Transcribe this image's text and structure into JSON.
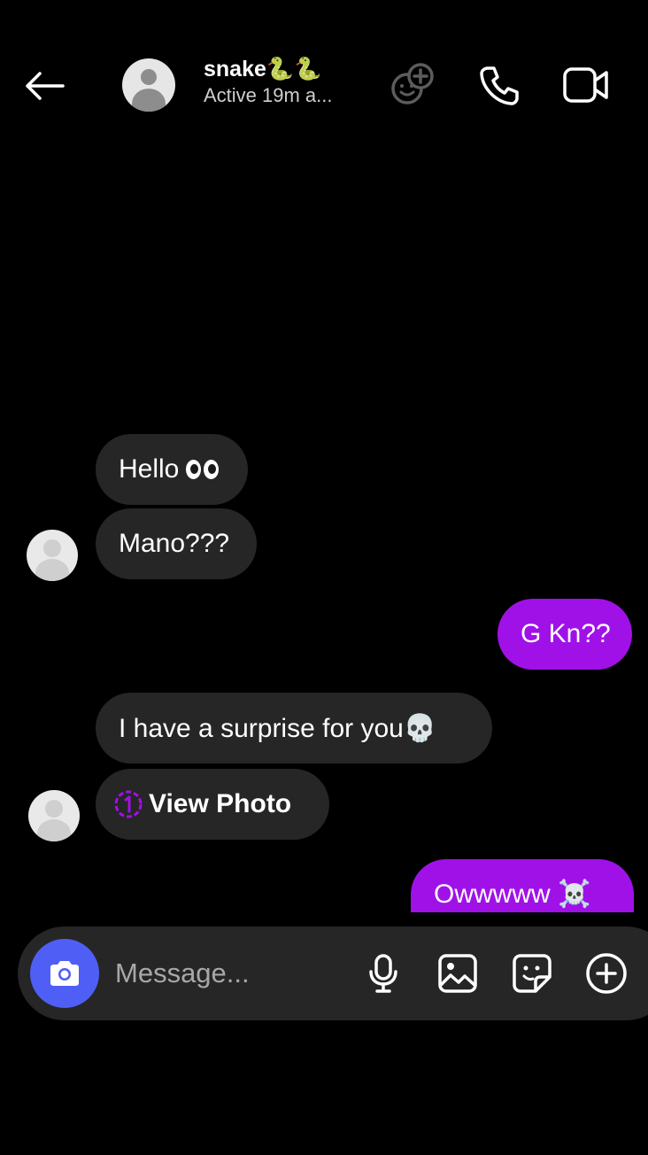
{
  "header": {
    "contact_name": "snake🐍🐍",
    "status": "Active 19m a..."
  },
  "messages": [
    {
      "direction": "incoming",
      "text": "Hello"
    },
    {
      "direction": "incoming",
      "text": "Mano???"
    },
    {
      "direction": "outgoing",
      "text": "G Kn??"
    },
    {
      "direction": "incoming",
      "text": "I have a surprise for you💀"
    },
    {
      "direction": "incoming",
      "text": "View Photo",
      "type": "view-once-photo"
    },
    {
      "direction": "outgoing",
      "text": "Owwwww ☠️"
    }
  ],
  "composer": {
    "placeholder": "Message..."
  },
  "icons": {
    "back": "arrow-left-icon",
    "effects": "effects-icon",
    "call": "phone-icon",
    "video": "video-camera-icon",
    "camera": "camera-icon",
    "mic": "microphone-icon",
    "gallery": "image-icon",
    "sticker": "sticker-icon",
    "plus": "plus-circle-icon"
  },
  "colors": {
    "background": "#000000",
    "incoming_bubble": "#262626",
    "outgoing_bubble": "#a011e8",
    "camera_button": "#4f5ff5",
    "status_text": "#cfcfcf",
    "view_once_icon": "#a011e8"
  }
}
